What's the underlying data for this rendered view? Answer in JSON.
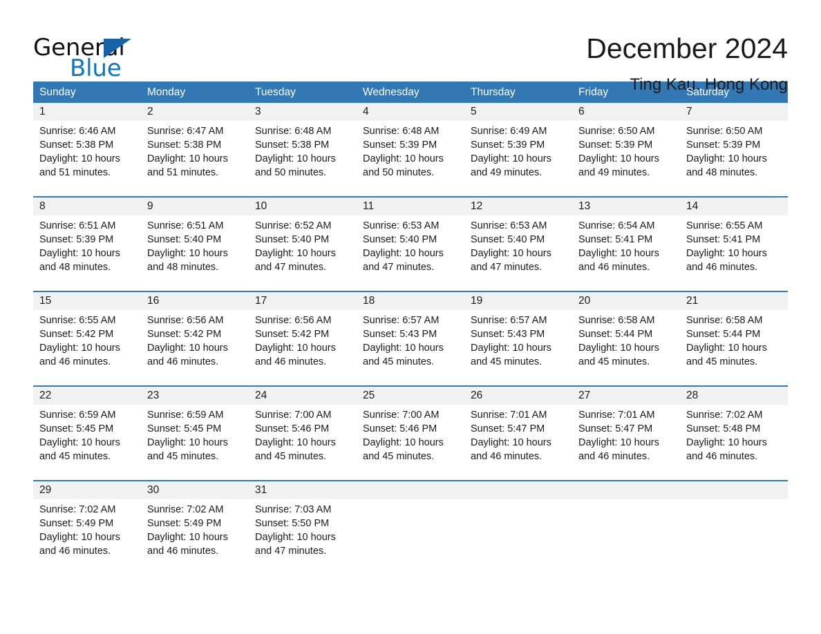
{
  "brand": {
    "word_general": "General",
    "word_blue": "Blue",
    "triangle_color": "#1663a8",
    "blue_color": "#0b76c4"
  },
  "header": {
    "title": "December 2024",
    "subtitle": "Ting Kau, Hong Kong"
  },
  "theme": {
    "header_band": "#3178b5",
    "date_band": "#f1f1f1",
    "text": "#1a1a1a"
  },
  "weekdays": [
    "Sunday",
    "Monday",
    "Tuesday",
    "Wednesday",
    "Thursday",
    "Friday",
    "Saturday"
  ],
  "weeks": [
    [
      {
        "day": "1",
        "lines": [
          "Sunrise: 6:46 AM",
          "Sunset: 5:38 PM",
          "Daylight: 10 hours",
          "and 51 minutes."
        ]
      },
      {
        "day": "2",
        "lines": [
          "Sunrise: 6:47 AM",
          "Sunset: 5:38 PM",
          "Daylight: 10 hours",
          "and 51 minutes."
        ]
      },
      {
        "day": "3",
        "lines": [
          "Sunrise: 6:48 AM",
          "Sunset: 5:38 PM",
          "Daylight: 10 hours",
          "and 50 minutes."
        ]
      },
      {
        "day": "4",
        "lines": [
          "Sunrise: 6:48 AM",
          "Sunset: 5:39 PM",
          "Daylight: 10 hours",
          "and 50 minutes."
        ]
      },
      {
        "day": "5",
        "lines": [
          "Sunrise: 6:49 AM",
          "Sunset: 5:39 PM",
          "Daylight: 10 hours",
          "and 49 minutes."
        ]
      },
      {
        "day": "6",
        "lines": [
          "Sunrise: 6:50 AM",
          "Sunset: 5:39 PM",
          "Daylight: 10 hours",
          "and 49 minutes."
        ]
      },
      {
        "day": "7",
        "lines": [
          "Sunrise: 6:50 AM",
          "Sunset: 5:39 PM",
          "Daylight: 10 hours",
          "and 48 minutes."
        ]
      }
    ],
    [
      {
        "day": "8",
        "lines": [
          "Sunrise: 6:51 AM",
          "Sunset: 5:39 PM",
          "Daylight: 10 hours",
          "and 48 minutes."
        ]
      },
      {
        "day": "9",
        "lines": [
          "Sunrise: 6:51 AM",
          "Sunset: 5:40 PM",
          "Daylight: 10 hours",
          "and 48 minutes."
        ]
      },
      {
        "day": "10",
        "lines": [
          "Sunrise: 6:52 AM",
          "Sunset: 5:40 PM",
          "Daylight: 10 hours",
          "and 47 minutes."
        ]
      },
      {
        "day": "11",
        "lines": [
          "Sunrise: 6:53 AM",
          "Sunset: 5:40 PM",
          "Daylight: 10 hours",
          "and 47 minutes."
        ]
      },
      {
        "day": "12",
        "lines": [
          "Sunrise: 6:53 AM",
          "Sunset: 5:40 PM",
          "Daylight: 10 hours",
          "and 47 minutes."
        ]
      },
      {
        "day": "13",
        "lines": [
          "Sunrise: 6:54 AM",
          "Sunset: 5:41 PM",
          "Daylight: 10 hours",
          "and 46 minutes."
        ]
      },
      {
        "day": "14",
        "lines": [
          "Sunrise: 6:55 AM",
          "Sunset: 5:41 PM",
          "Daylight: 10 hours",
          "and 46 minutes."
        ]
      }
    ],
    [
      {
        "day": "15",
        "lines": [
          "Sunrise: 6:55 AM",
          "Sunset: 5:42 PM",
          "Daylight: 10 hours",
          "and 46 minutes."
        ]
      },
      {
        "day": "16",
        "lines": [
          "Sunrise: 6:56 AM",
          "Sunset: 5:42 PM",
          "Daylight: 10 hours",
          "and 46 minutes."
        ]
      },
      {
        "day": "17",
        "lines": [
          "Sunrise: 6:56 AM",
          "Sunset: 5:42 PM",
          "Daylight: 10 hours",
          "and 46 minutes."
        ]
      },
      {
        "day": "18",
        "lines": [
          "Sunrise: 6:57 AM",
          "Sunset: 5:43 PM",
          "Daylight: 10 hours",
          "and 45 minutes."
        ]
      },
      {
        "day": "19",
        "lines": [
          "Sunrise: 6:57 AM",
          "Sunset: 5:43 PM",
          "Daylight: 10 hours",
          "and 45 minutes."
        ]
      },
      {
        "day": "20",
        "lines": [
          "Sunrise: 6:58 AM",
          "Sunset: 5:44 PM",
          "Daylight: 10 hours",
          "and 45 minutes."
        ]
      },
      {
        "day": "21",
        "lines": [
          "Sunrise: 6:58 AM",
          "Sunset: 5:44 PM",
          "Daylight: 10 hours",
          "and 45 minutes."
        ]
      }
    ],
    [
      {
        "day": "22",
        "lines": [
          "Sunrise: 6:59 AM",
          "Sunset: 5:45 PM",
          "Daylight: 10 hours",
          "and 45 minutes."
        ]
      },
      {
        "day": "23",
        "lines": [
          "Sunrise: 6:59 AM",
          "Sunset: 5:45 PM",
          "Daylight: 10 hours",
          "and 45 minutes."
        ]
      },
      {
        "day": "24",
        "lines": [
          "Sunrise: 7:00 AM",
          "Sunset: 5:46 PM",
          "Daylight: 10 hours",
          "and 45 minutes."
        ]
      },
      {
        "day": "25",
        "lines": [
          "Sunrise: 7:00 AM",
          "Sunset: 5:46 PM",
          "Daylight: 10 hours",
          "and 45 minutes."
        ]
      },
      {
        "day": "26",
        "lines": [
          "Sunrise: 7:01 AM",
          "Sunset: 5:47 PM",
          "Daylight: 10 hours",
          "and 46 minutes."
        ]
      },
      {
        "day": "27",
        "lines": [
          "Sunrise: 7:01 AM",
          "Sunset: 5:47 PM",
          "Daylight: 10 hours",
          "and 46 minutes."
        ]
      },
      {
        "day": "28",
        "lines": [
          "Sunrise: 7:02 AM",
          "Sunset: 5:48 PM",
          "Daylight: 10 hours",
          "and 46 minutes."
        ]
      }
    ],
    [
      {
        "day": "29",
        "lines": [
          "Sunrise: 7:02 AM",
          "Sunset: 5:49 PM",
          "Daylight: 10 hours",
          "and 46 minutes."
        ]
      },
      {
        "day": "30",
        "lines": [
          "Sunrise: 7:02 AM",
          "Sunset: 5:49 PM",
          "Daylight: 10 hours",
          "and 46 minutes."
        ]
      },
      {
        "day": "31",
        "lines": [
          "Sunrise: 7:03 AM",
          "Sunset: 5:50 PM",
          "Daylight: 10 hours",
          "and 47 minutes."
        ]
      },
      {
        "day": "",
        "lines": []
      },
      {
        "day": "",
        "lines": []
      },
      {
        "day": "",
        "lines": []
      },
      {
        "day": "",
        "lines": []
      }
    ]
  ]
}
